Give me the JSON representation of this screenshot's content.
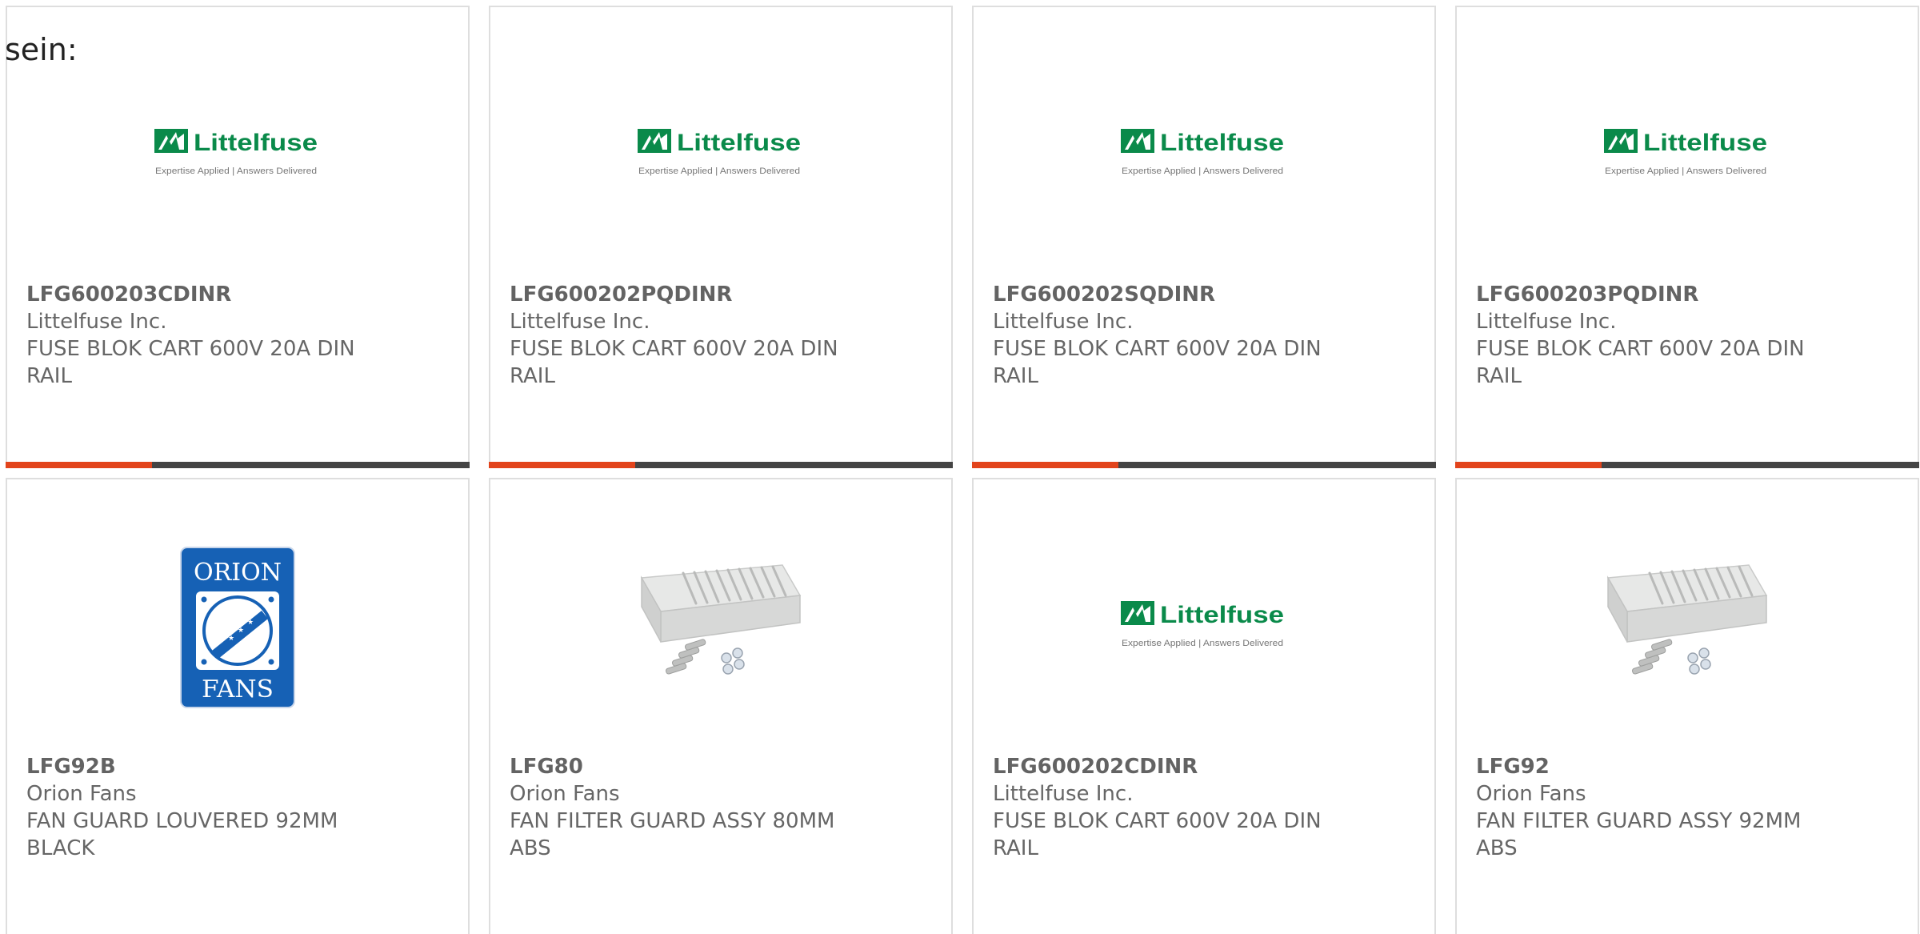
{
  "overlay_text": "sein:",
  "colors": {
    "accent": "#e2441c",
    "bar": "#444444",
    "text": "#666666",
    "border": "#dedede",
    "littelfuse_green": "#0a8a4a",
    "orion_blue": "#1661b5"
  },
  "cards": [
    {
      "part_number": "LFG600203CDINR",
      "manufacturer": "Littelfuse Inc.",
      "description": "FUSE BLOK CART 600V 20A DIN RAIL",
      "image": "littelfuse-logo",
      "logo_name": "Littelfuse",
      "logo_tagline": "Expertise Applied | Answers Delivered"
    },
    {
      "part_number": "LFG600202PQDINR",
      "manufacturer": "Littelfuse Inc.",
      "description": "FUSE BLOK CART 600V 20A DIN RAIL",
      "image": "littelfuse-logo",
      "logo_name": "Littelfuse",
      "logo_tagline": "Expertise Applied | Answers Delivered"
    },
    {
      "part_number": "LFG600202SQDINR",
      "manufacturer": "Littelfuse Inc.",
      "description": "FUSE BLOK CART 600V 20A DIN RAIL",
      "image": "littelfuse-logo",
      "logo_name": "Littelfuse",
      "logo_tagline": "Expertise Applied | Answers Delivered"
    },
    {
      "part_number": "LFG600203PQDINR",
      "manufacturer": "Littelfuse Inc.",
      "description": "FUSE BLOK CART 600V 20A DIN RAIL",
      "image": "littelfuse-logo",
      "logo_name": "Littelfuse",
      "logo_tagline": "Expertise Applied | Answers Delivered"
    },
    {
      "part_number": "LFG92B",
      "manufacturer": "Orion Fans",
      "description": "FAN GUARD LOUVERED 92MM BLACK",
      "image": "orion-fans-logo",
      "logo_top": "ORION",
      "logo_bottom": "FANS"
    },
    {
      "part_number": "LFG80",
      "manufacturer": "Orion Fans",
      "description": "FAN FILTER GUARD ASSY 80MM ABS",
      "image": "fan-filter-guard-photo"
    },
    {
      "part_number": "LFG600202CDINR",
      "manufacturer": "Littelfuse Inc.",
      "description": "FUSE BLOK CART 600V 20A DIN RAIL",
      "image": "littelfuse-logo",
      "logo_name": "Littelfuse",
      "logo_tagline": "Expertise Applied | Answers Delivered"
    },
    {
      "part_number": "LFG92",
      "manufacturer": "Orion Fans",
      "description": "FAN FILTER GUARD ASSY 92MM ABS",
      "image": "fan-filter-guard-photo"
    }
  ]
}
